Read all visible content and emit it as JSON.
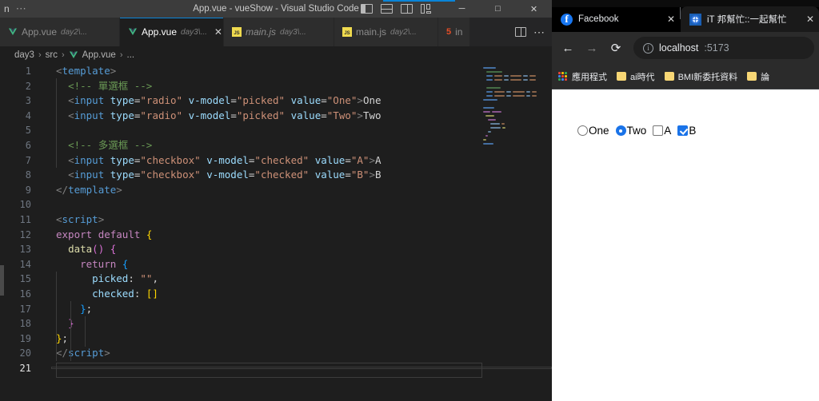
{
  "vscode": {
    "titlebar": {
      "menu_partial": "n",
      "more_label": "⋯",
      "title": "App.vue - vueShow - Visual Studio Code",
      "layout_icons": [
        "toggle-primary-sidebar-icon",
        "toggle-panel-icon",
        "toggle-secondary-sidebar-icon",
        "customize-layout-icon"
      ],
      "minimize_label": "─",
      "maximize_label": "□",
      "close_label": "✕"
    },
    "tabs": [
      {
        "icon": "vue-file-icon",
        "name": "App.vue",
        "path": "day2\\...",
        "active": false,
        "italic": false,
        "closable": false
      },
      {
        "icon": "vue-file-icon",
        "name": "App.vue",
        "path": "day3\\...",
        "active": true,
        "italic": false,
        "closable": true,
        "close_label": "✕"
      },
      {
        "icon": "js-file-icon",
        "name": "main.js",
        "path": "day3\\...",
        "active": false,
        "italic": true,
        "closable": false
      },
      {
        "icon": "js-file-icon",
        "name": "main.js",
        "path": "day2\\...",
        "active": false,
        "italic": false,
        "closable": false
      },
      {
        "icon": "html-file-icon",
        "name": "in",
        "path": "",
        "active": false,
        "italic": false,
        "closable": false
      }
    ],
    "tabbar_actions": {
      "split_editor": "split-editor-icon",
      "more": "⋯"
    },
    "breadcrumb": {
      "items": [
        "day3",
        "src",
        "App.vue",
        "..."
      ],
      "separator": "›",
      "file_icon": "vue-file-icon"
    },
    "editor": {
      "current_line": 21,
      "lines": [
        {
          "n": 1,
          "tokens": [
            {
              "t": "<",
              "c": "t-punct"
            },
            {
              "t": "template",
              "c": "t-tag"
            },
            {
              "t": ">",
              "c": "t-punct"
            }
          ]
        },
        {
          "n": 2,
          "tokens": [
            {
              "t": "  ",
              "c": "t-plain"
            },
            {
              "t": "<!-- 單選框 -->",
              "c": "t-comment"
            }
          ]
        },
        {
          "n": 3,
          "tokens": [
            {
              "t": "  ",
              "c": "t-plain"
            },
            {
              "t": "<",
              "c": "t-punct"
            },
            {
              "t": "input",
              "c": "t-tag"
            },
            {
              "t": " ",
              "c": "t-plain"
            },
            {
              "t": "type",
              "c": "t-attr"
            },
            {
              "t": "=",
              "c": "t-eq"
            },
            {
              "t": "\"radio\"",
              "c": "t-string"
            },
            {
              "t": " ",
              "c": "t-plain"
            },
            {
              "t": "v-model",
              "c": "t-attr"
            },
            {
              "t": "=",
              "c": "t-eq"
            },
            {
              "t": "\"picked\"",
              "c": "t-string"
            },
            {
              "t": " ",
              "c": "t-plain"
            },
            {
              "t": "value",
              "c": "t-attr"
            },
            {
              "t": "=",
              "c": "t-eq"
            },
            {
              "t": "\"One\"",
              "c": "t-string"
            },
            {
              "t": ">",
              "c": "t-punct"
            },
            {
              "t": "One",
              "c": "t-plain"
            }
          ]
        },
        {
          "n": 4,
          "tokens": [
            {
              "t": "  ",
              "c": "t-plain"
            },
            {
              "t": "<",
              "c": "t-punct"
            },
            {
              "t": "input",
              "c": "t-tag"
            },
            {
              "t": " ",
              "c": "t-plain"
            },
            {
              "t": "type",
              "c": "t-attr"
            },
            {
              "t": "=",
              "c": "t-eq"
            },
            {
              "t": "\"radio\"",
              "c": "t-string"
            },
            {
              "t": " ",
              "c": "t-plain"
            },
            {
              "t": "v-model",
              "c": "t-attr"
            },
            {
              "t": "=",
              "c": "t-eq"
            },
            {
              "t": "\"picked\"",
              "c": "t-string"
            },
            {
              "t": " ",
              "c": "t-plain"
            },
            {
              "t": "value",
              "c": "t-attr"
            },
            {
              "t": "=",
              "c": "t-eq"
            },
            {
              "t": "\"Two\"",
              "c": "t-string"
            },
            {
              "t": ">",
              "c": "t-punct"
            },
            {
              "t": "Two",
              "c": "t-plain"
            }
          ]
        },
        {
          "n": 5,
          "tokens": []
        },
        {
          "n": 6,
          "tokens": [
            {
              "t": "  ",
              "c": "t-plain"
            },
            {
              "t": "<!-- 多選框 -->",
              "c": "t-comment"
            }
          ]
        },
        {
          "n": 7,
          "tokens": [
            {
              "t": "  ",
              "c": "t-plain"
            },
            {
              "t": "<",
              "c": "t-punct"
            },
            {
              "t": "input",
              "c": "t-tag"
            },
            {
              "t": " ",
              "c": "t-plain"
            },
            {
              "t": "type",
              "c": "t-attr"
            },
            {
              "t": "=",
              "c": "t-eq"
            },
            {
              "t": "\"checkbox\"",
              "c": "t-string"
            },
            {
              "t": " ",
              "c": "t-plain"
            },
            {
              "t": "v-model",
              "c": "t-attr"
            },
            {
              "t": "=",
              "c": "t-eq"
            },
            {
              "t": "\"checked\"",
              "c": "t-string"
            },
            {
              "t": " ",
              "c": "t-plain"
            },
            {
              "t": "value",
              "c": "t-attr"
            },
            {
              "t": "=",
              "c": "t-eq"
            },
            {
              "t": "\"A\"",
              "c": "t-string"
            },
            {
              "t": ">",
              "c": "t-punct"
            },
            {
              "t": "A",
              "c": "t-plain"
            }
          ]
        },
        {
          "n": 8,
          "tokens": [
            {
              "t": "  ",
              "c": "t-plain"
            },
            {
              "t": "<",
              "c": "t-punct"
            },
            {
              "t": "input",
              "c": "t-tag"
            },
            {
              "t": " ",
              "c": "t-plain"
            },
            {
              "t": "type",
              "c": "t-attr"
            },
            {
              "t": "=",
              "c": "t-eq"
            },
            {
              "t": "\"checkbox\"",
              "c": "t-string"
            },
            {
              "t": " ",
              "c": "t-plain"
            },
            {
              "t": "v-model",
              "c": "t-attr"
            },
            {
              "t": "=",
              "c": "t-eq"
            },
            {
              "t": "\"checked\"",
              "c": "t-string"
            },
            {
              "t": " ",
              "c": "t-plain"
            },
            {
              "t": "value",
              "c": "t-attr"
            },
            {
              "t": "=",
              "c": "t-eq"
            },
            {
              "t": "\"B\"",
              "c": "t-string"
            },
            {
              "t": ">",
              "c": "t-punct"
            },
            {
              "t": "B",
              "c": "t-plain"
            }
          ]
        },
        {
          "n": 9,
          "tokens": [
            {
              "t": "</",
              "c": "t-punct"
            },
            {
              "t": "template",
              "c": "t-tag"
            },
            {
              "t": ">",
              "c": "t-punct"
            }
          ]
        },
        {
          "n": 10,
          "tokens": []
        },
        {
          "n": 11,
          "tokens": [
            {
              "t": "<",
              "c": "t-punct"
            },
            {
              "t": "script",
              "c": "t-tag"
            },
            {
              "t": ">",
              "c": "t-punct"
            }
          ]
        },
        {
          "n": 12,
          "tokens": [
            {
              "t": "export",
              "c": "t-kw"
            },
            {
              "t": " ",
              "c": "t-plain"
            },
            {
              "t": "default",
              "c": "t-kw"
            },
            {
              "t": " ",
              "c": "t-plain"
            },
            {
              "t": "{",
              "c": "t-br-y"
            }
          ]
        },
        {
          "n": 13,
          "tokens": [
            {
              "t": "  ",
              "c": "t-plain"
            },
            {
              "t": "data",
              "c": "t-fn"
            },
            {
              "t": "()",
              "c": "t-br-p"
            },
            {
              "t": " ",
              "c": "t-plain"
            },
            {
              "t": "{",
              "c": "t-br-p"
            }
          ]
        },
        {
          "n": 14,
          "tokens": [
            {
              "t": "    ",
              "c": "t-plain"
            },
            {
              "t": "return",
              "c": "t-kw"
            },
            {
              "t": " ",
              "c": "t-plain"
            },
            {
              "t": "{",
              "c": "t-br-b"
            }
          ]
        },
        {
          "n": 15,
          "tokens": [
            {
              "t": "      ",
              "c": "t-plain"
            },
            {
              "t": "picked",
              "c": "t-prop"
            },
            {
              "t": ": ",
              "c": "t-plain"
            },
            {
              "t": "\"\"",
              "c": "t-string"
            },
            {
              "t": ",",
              "c": "t-plain"
            }
          ]
        },
        {
          "n": 16,
          "tokens": [
            {
              "t": "      ",
              "c": "t-plain"
            },
            {
              "t": "checked",
              "c": "t-prop"
            },
            {
              "t": ": ",
              "c": "t-plain"
            },
            {
              "t": "[]",
              "c": "t-br-y"
            }
          ]
        },
        {
          "n": 17,
          "tokens": [
            {
              "t": "    ",
              "c": "t-plain"
            },
            {
              "t": "}",
              "c": "t-br-b"
            },
            {
              "t": ";",
              "c": "t-plain"
            }
          ]
        },
        {
          "n": 18,
          "tokens": [
            {
              "t": "  ",
              "c": "t-plain"
            },
            {
              "t": "}",
              "c": "t-br-p"
            }
          ]
        },
        {
          "n": 19,
          "tokens": [
            {
              "t": "}",
              "c": "t-br-y"
            },
            {
              "t": ";",
              "c": "t-plain"
            }
          ]
        },
        {
          "n": 20,
          "tokens": [
            {
              "t": "</",
              "c": "t-punct"
            },
            {
              "t": "script",
              "c": "t-tag"
            },
            {
              "t": ">",
              "c": "t-punct"
            }
          ]
        },
        {
          "n": 21,
          "tokens": []
        }
      ]
    },
    "minimap": {
      "name": "editor-minimap"
    }
  },
  "browser": {
    "tabs": [
      {
        "icon": "facebook-icon",
        "icon_glyph": "f",
        "title": "Facebook",
        "active": false,
        "close_label": "✕"
      },
      {
        "icon": "ithelp-icon",
        "icon_glyph": "⬤",
        "title": "iT 邦幫忙::一起幫忙",
        "active": true,
        "close_label": "✕"
      }
    ],
    "toolbar": {
      "back_label": "←",
      "forward_label": "→",
      "reload_label": "⟳",
      "omnibox": {
        "info_glyph": "i",
        "host": "localhost",
        "port": ":5173"
      }
    },
    "bookmarks": [
      {
        "icon": "apps-grid-icon",
        "label": "應用程式"
      },
      {
        "icon": "folder-icon",
        "label": "ai時代"
      },
      {
        "icon": "folder-icon",
        "label": "BMI新委托資料"
      },
      {
        "icon": "folder-icon",
        "label": "論"
      }
    ],
    "page": {
      "controls": [
        {
          "type": "radio",
          "checked": false,
          "label": "One"
        },
        {
          "type": "radio",
          "checked": true,
          "label": "Two"
        },
        {
          "type": "checkbox",
          "checked": false,
          "label": "A"
        },
        {
          "type": "checkbox",
          "checked": true,
          "label": "B"
        }
      ]
    }
  },
  "colors": {
    "vscode_bg": "#1e1e1e",
    "vscode_titlebar": "#3c3c3c",
    "vscode_tabbar": "#252526",
    "accent_blue": "#0a84d8",
    "browser_chrome": "#2b2b2b",
    "browser_tabstrip": "#000000",
    "control_accent": "#1a73e8",
    "facebook_blue": "#1877f2"
  }
}
